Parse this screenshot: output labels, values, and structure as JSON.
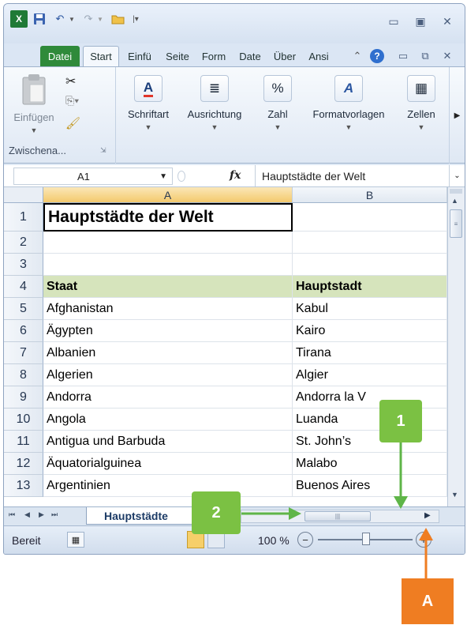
{
  "quick_access": {
    "excel_icon": "excel-logo-icon",
    "save_icon": "save-icon",
    "undo_icon": "undo-icon",
    "redo_icon": "redo-icon",
    "open_icon": "open-folder-icon",
    "customize_icon": "customize-qat-icon"
  },
  "tabs": [
    "Datei",
    "Start",
    "Einfü",
    "Seite",
    "Form",
    "Date",
    "Über",
    "Ansi"
  ],
  "ribbon": {
    "paste_label": "Einfügen",
    "clipboard_group": "Zwischena...",
    "font_label": "Schriftart",
    "alignment_label": "Ausrichtung",
    "number_label": "Zahl",
    "styles_label": "Formatvorlagen",
    "cells_label": "Zellen"
  },
  "formula_bar": {
    "name_box": "A1",
    "fx": "fx",
    "content": "Hauptstädte der Welt"
  },
  "grid": {
    "columns": [
      "A",
      "B"
    ],
    "rows": [
      {
        "n": "1",
        "a": "Hauptstädte der Welt",
        "b": ""
      },
      {
        "n": "2",
        "a": "",
        "b": ""
      },
      {
        "n": "3",
        "a": "",
        "b": ""
      },
      {
        "n": "4",
        "a": "Staat",
        "b": "Hauptstadt"
      },
      {
        "n": "5",
        "a": "Afghanistan",
        "b": "Kabul"
      },
      {
        "n": "6",
        "a": "Ägypten",
        "b": "Kairo"
      },
      {
        "n": "7",
        "a": "Albanien",
        "b": "Tirana"
      },
      {
        "n": "8",
        "a": "Algerien",
        "b": "Algier"
      },
      {
        "n": "9",
        "a": "Andorra",
        "b": "Andorra la V"
      },
      {
        "n": "10",
        "a": "Angola",
        "b": "Luanda"
      },
      {
        "n": "11",
        "a": "Antigua und Barbuda",
        "b": "St. John’s"
      },
      {
        "n": "12",
        "a": "Äquatorialguinea",
        "b": "Malabo"
      },
      {
        "n": "13",
        "a": "Argentinien",
        "b": "Buenos Aires"
      }
    ]
  },
  "sheet_tab": "Hauptstädte",
  "status": {
    "ready": "Bereit",
    "zoom": "100 %"
  },
  "callouts": {
    "one": "1",
    "two": "2",
    "a": "A"
  },
  "colors": {
    "callout_green": "#7bc143",
    "callout_orange": "#ef7d22",
    "header_fill": "#d6e4bc",
    "file_tab": "#2f8a3a"
  }
}
